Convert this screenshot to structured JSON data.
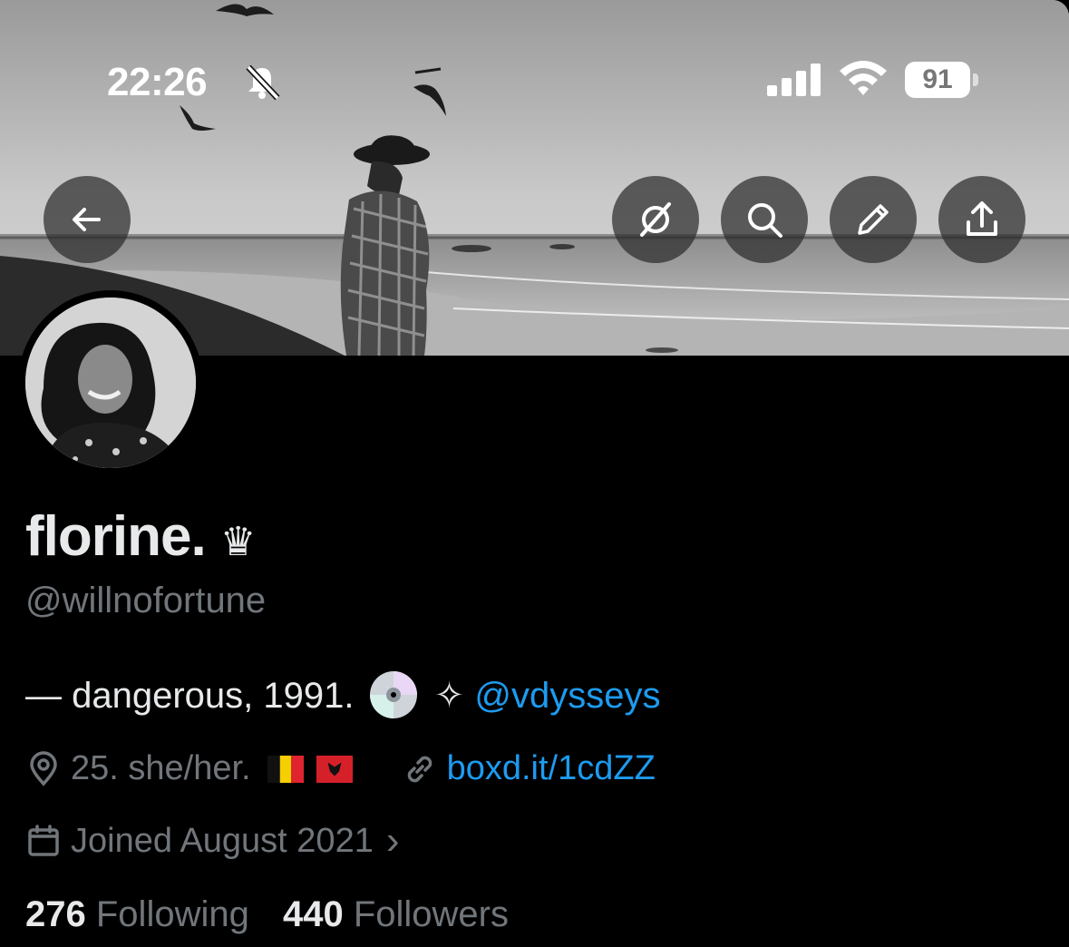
{
  "status_bar": {
    "time": "22:26",
    "battery": "91"
  },
  "nav": {
    "back": "back-arrow-icon",
    "actions": [
      "grok-icon",
      "search-icon",
      "edit-icon",
      "share-icon"
    ]
  },
  "profile": {
    "name": "florine.",
    "name_emoji": "♛",
    "handle": "@willnofortune",
    "bio_prefix": "— dangerous, 1991.",
    "bio_sparkle": "✧",
    "bio_mention": "@vdysseys",
    "location": "25. she/her.",
    "website": "boxd.it/1cdZZ",
    "joined": "Joined August 2021",
    "joined_chevron": "›",
    "following_count": "276",
    "following_label": "Following",
    "followers_count": "440",
    "followers_label": "Followers"
  },
  "colors": {
    "accent": "#1d9bf0",
    "muted": "#71767b",
    "text": "#e7e9ea"
  }
}
